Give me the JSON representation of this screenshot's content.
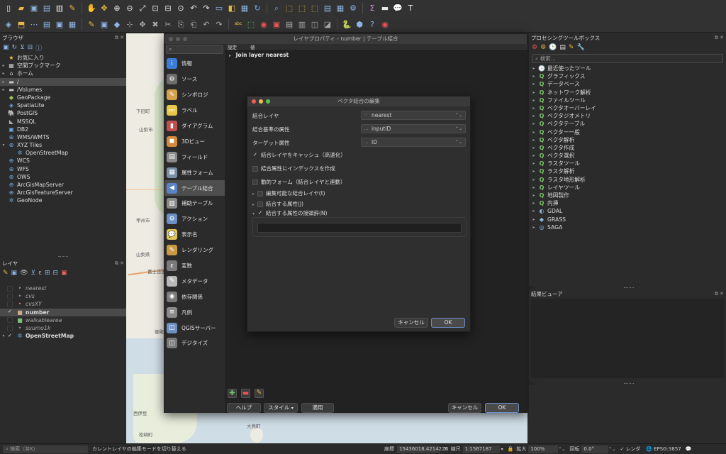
{
  "toolbar1_icons": [
    "new-project-icon",
    "open-folder-icon",
    "save-icon",
    "save-as-icon",
    "print-layout-icon",
    "style-manager-icon",
    "pan-icon",
    "pan-to-selection-icon",
    "zoom-in-icon",
    "zoom-out-icon",
    "zoom-full-icon",
    "zoom-selection-icon",
    "zoom-layer-icon",
    "zoom-native-icon",
    "zoom-last-icon",
    "zoom-next-icon",
    "new-map-view-icon",
    "bookmark-icon",
    "show-bookmarks-icon",
    "refresh-icon",
    "identify-icon",
    "select-features-icon",
    "select-by-value-icon",
    "deselect-icon",
    "attribute-table-icon",
    "field-calculator-icon",
    "processing-gear-icon",
    "statistics-sum-icon",
    "measure-icon",
    "tips-icon",
    "text-annotation-icon"
  ],
  "toolbar2_icons": [
    "digitize-icon",
    "manage-layers-icon",
    "add-vector-icon",
    "add-raster-icon",
    "add-mesh-icon",
    "add-delimited-icon",
    "edit-pencil-icon",
    "save-edits-icon",
    "add-feature-icon",
    "vertex-tool-icon",
    "move-feature-icon",
    "delete-feature-icon",
    "cut-icon",
    "copy-icon",
    "paste-icon",
    "undo-icon",
    "redo-icon",
    "label-abc-icon",
    "label-pin-icon",
    "label-highlight-icon",
    "label-show-icon",
    "label-move-icon",
    "label-rotate-icon",
    "label-change-icon",
    "label-diagram-icon",
    "python-icon",
    "plugin-icon",
    "help-icon",
    "rec-icon"
  ],
  "browser": {
    "title": "ブラウザ",
    "items": [
      {
        "icon": "★",
        "label": "お気に入り",
        "arrow": "",
        "color": "#f2c744"
      },
      {
        "icon": "▦",
        "label": "空間ブックマーク",
        "arrow": "▸",
        "color": "#c8c8c8"
      },
      {
        "icon": "⌂",
        "label": "ホーム",
        "arrow": "▸",
        "color": "#c8c8c8"
      },
      {
        "icon": "▬",
        "label": "/",
        "arrow": "▸",
        "color": "#c8c8c8",
        "selected": true
      },
      {
        "icon": "▬",
        "label": "/Volumes",
        "arrow": "▸",
        "color": "#c8c8c8"
      },
      {
        "icon": "◆",
        "label": "GeoPackage",
        "arrow": "",
        "color": "#9acb5c"
      },
      {
        "icon": "◈",
        "label": "SpatiaLite",
        "arrow": "",
        "color": "#6fa8dc"
      },
      {
        "icon": "🐘",
        "label": "PostGIS",
        "arrow": "",
        "color": "#6fa8dc"
      },
      {
        "icon": "◣",
        "label": "MSSQL",
        "arrow": "",
        "color": "#aaaaaa"
      },
      {
        "icon": "▣",
        "label": "DB2",
        "arrow": "",
        "color": "#6fa8dc"
      },
      {
        "icon": "⊕",
        "label": "WMS/WMTS",
        "arrow": "",
        "color": "#6fa8dc"
      },
      {
        "icon": "⊕",
        "label": "XYZ Tiles",
        "arrow": "▾",
        "color": "#6fa8dc"
      },
      {
        "icon": "✲",
        "label": "OpenStreetMap",
        "arrow": "",
        "color": "#6fa8dc",
        "indent": true
      },
      {
        "icon": "⊕",
        "label": "WCS",
        "arrow": "",
        "color": "#6fa8dc"
      },
      {
        "icon": "⊕",
        "label": "WFS",
        "arrow": "",
        "color": "#6fa8dc"
      },
      {
        "icon": "⊕",
        "label": "OWS",
        "arrow": "",
        "color": "#6fa8dc"
      },
      {
        "icon": "⊕",
        "label": "ArcGisMapServer",
        "arrow": "",
        "color": "#6fa8dc"
      },
      {
        "icon": "⊕",
        "label": "ArcGisFeatureServer",
        "arrow": "",
        "color": "#6fa8dc"
      },
      {
        "icon": "✲",
        "label": "GeoNode",
        "arrow": "",
        "color": "#6fa8dc"
      }
    ]
  },
  "layers": {
    "title": "レイヤ",
    "items": [
      {
        "label": "nearest",
        "checked": false,
        "italic": true,
        "swatch": "•",
        "swatch_color": "#999"
      },
      {
        "label": "cvs",
        "checked": false,
        "italic": true,
        "swatch": "•",
        "swatch_color": "#999"
      },
      {
        "label": "cvsXY",
        "checked": false,
        "italic": true,
        "swatch": "•",
        "swatch_color": "#e07a5f"
      },
      {
        "label": "number",
        "checked": true,
        "italic": false,
        "bold": true,
        "swatch": "■",
        "swatch_color": "#c9a98a",
        "selected": true
      },
      {
        "label": "walkablearea",
        "checked": false,
        "italic": true,
        "swatch": "■",
        "swatch_color": "#7fbf7f"
      },
      {
        "label": "suumo1k",
        "checked": false,
        "italic": true,
        "swatch": "•",
        "swatch_color": "#999"
      },
      {
        "label": "OpenStreetMap",
        "checked": true,
        "italic": false,
        "bold": true,
        "swatch": "✲",
        "swatch_color": "#6fa8dc",
        "arrow": "▾"
      }
    ]
  },
  "map_labels": [
    "下旧町",
    "甲州市",
    "山梨県",
    "富士吉田",
    "御殿場",
    "平塚",
    "伊東",
    "大島町",
    "西伊豆",
    "松崎町",
    "山梨市",
    "田原市"
  ],
  "props_dialog": {
    "title": "レイヤプロパティ - number | テーブル結合",
    "search_placeholder": "",
    "sidebar": [
      {
        "label": "情報",
        "icon": "i",
        "color": "#3b7dd8"
      },
      {
        "label": "ソース",
        "icon": "⚙",
        "color": "#6d6d6d"
      },
      {
        "label": "シンボロジ",
        "icon": "✎",
        "color": "#d2a24c"
      },
      {
        "label": "ラベル",
        "icon": "abc",
        "color": "#e6c74a"
      },
      {
        "label": "ダイアグラム",
        "icon": "▮",
        "color": "#c0504d"
      },
      {
        "label": "3Dビュー",
        "icon": "◼",
        "color": "#d18b3c"
      },
      {
        "label": "フィールド",
        "icon": "▤",
        "color": "#8a8a8a"
      },
      {
        "label": "属性フォーム",
        "icon": "▦",
        "color": "#7a8fa8"
      },
      {
        "label": "テーブル結合",
        "icon": "◀",
        "color": "#5b84c4",
        "active": true
      },
      {
        "label": "補助テーブル",
        "icon": "▥",
        "color": "#8a8a8a"
      },
      {
        "label": "アクション",
        "icon": "⚙",
        "color": "#6d8fc4"
      },
      {
        "label": "表示名",
        "icon": "💬",
        "color": "#e3c65a"
      },
      {
        "label": "レンダリング",
        "icon": "✎",
        "color": "#c79a43"
      },
      {
        "label": "変数",
        "icon": "ε",
        "color": "#7a7a7a"
      },
      {
        "label": "メタデータ",
        "icon": "✎",
        "color": "#b8b8b8"
      },
      {
        "label": "依存関係",
        "icon": "◉",
        "color": "#7a7a7a"
      },
      {
        "label": "凡例",
        "icon": "≡",
        "color": "#8a8a8a"
      },
      {
        "label": "QGISサーバー",
        "icon": "◫",
        "color": "#6d8fc4"
      },
      {
        "label": "デジタイズ",
        "icon": "◫",
        "color": "#7a7a7a"
      }
    ],
    "header_setting": "設定",
    "header_value": "値",
    "join_row": "Join layer  nearest",
    "buttons": {
      "help": "ヘルプ",
      "style": "スタイル",
      "apply": "適用",
      "cancel": "キャンセル",
      "ok": "OK"
    }
  },
  "join_dialog": {
    "title": "ベクタ結合の編集",
    "join_layer_label": "結合レイヤ",
    "join_layer_value": "nearest",
    "join_field_label": "結合基準の属性",
    "join_field_value": "inputID",
    "target_field_label": "ターゲット属性",
    "target_field_value": "ID",
    "cache_label": "結合レイヤをキャッシュ（高速化）",
    "index_label": "結合属性にインデックスを作成",
    "dynamic_label": "動的フォーム（結合レイヤと連動）",
    "editable_label": "編集可能な結合レイヤ(t)",
    "fields_label": "結合する属性(J)",
    "prefix_label": "結合する属性の接頭辞(N)",
    "cancel": "キャンセル",
    "ok": "OK"
  },
  "processing": {
    "title": "プロセシングツールボックス",
    "search_placeholder": "検索...",
    "items": [
      {
        "label": "最近使ったツール",
        "icon": "🕒"
      },
      {
        "label": "グラフィックス",
        "icon": "Q"
      },
      {
        "label": "データベース",
        "icon": "Q"
      },
      {
        "label": "ネットワーク解析",
        "icon": "Q"
      },
      {
        "label": "ファイルツール",
        "icon": "Q"
      },
      {
        "label": "ベクタオーバーレイ",
        "icon": "Q"
      },
      {
        "label": "ベクタジオメトリ",
        "icon": "Q"
      },
      {
        "label": "ベクタテーブル",
        "icon": "Q"
      },
      {
        "label": "ベクター一般",
        "icon": "Q"
      },
      {
        "label": "ベクタ解析",
        "icon": "Q"
      },
      {
        "label": "ベクタ作成",
        "icon": "Q"
      },
      {
        "label": "ベクタ選択",
        "icon": "Q"
      },
      {
        "label": "ラスタツール",
        "icon": "Q"
      },
      {
        "label": "ラスタ解析",
        "icon": "Q"
      },
      {
        "label": "ラスタ地形解析",
        "icon": "Q"
      },
      {
        "label": "レイヤツール",
        "icon": "Q"
      },
      {
        "label": "地図製作",
        "icon": "Q"
      },
      {
        "label": "内挿",
        "icon": "Q"
      },
      {
        "label": "GDAL",
        "icon": "◐"
      },
      {
        "label": "GRASS",
        "icon": "◆"
      },
      {
        "label": "SAGA",
        "icon": "◎"
      }
    ]
  },
  "results_viewer": {
    "title": "結果ビューア"
  },
  "status": {
    "search_placeholder": "検索（⌘K）",
    "message": "カレントレイヤの編集モードを切り替える",
    "coord_label": "座標",
    "coord_value": "15436018,4214226",
    "scale_label": "縮尺",
    "scale_value": "1:1567187",
    "mag_label": "拡大",
    "mag_value": "100%",
    "rot_label": "回転",
    "rot_value": "0.0°",
    "render_label": "レンダ",
    "crs": "EPSG:3857"
  }
}
